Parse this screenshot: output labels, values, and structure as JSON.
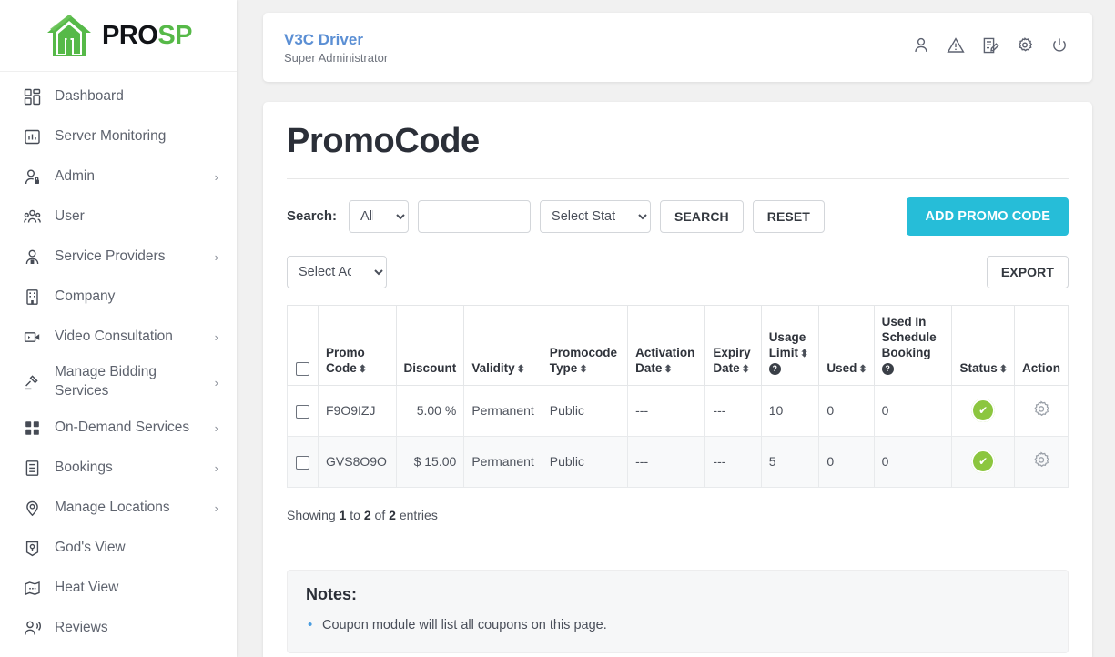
{
  "brand": {
    "logo_pro": "PRO",
    "logo_sp": "SP",
    "logo_icon": "house-icon",
    "green": "#56b948"
  },
  "sidebar": {
    "items": [
      {
        "label": "Dashboard",
        "icon": "grid-dashboard-icon",
        "caret": ""
      },
      {
        "label": "Server Monitoring",
        "icon": "chart-monitor-icon",
        "caret": ""
      },
      {
        "label": "Admin",
        "icon": "user-lock-icon",
        "caret": "›"
      },
      {
        "label": "User",
        "icon": "users-group-icon",
        "caret": ""
      },
      {
        "label": "Service Providers",
        "icon": "user-badge-icon",
        "caret": "›"
      },
      {
        "label": "Company",
        "icon": "building-icon",
        "caret": ""
      },
      {
        "label": "Video Consultation",
        "icon": "video-camera-icon",
        "caret": "›"
      },
      {
        "label": "Manage Bidding Services",
        "icon": "gavel-icon",
        "caret": "›"
      },
      {
        "label": "On-Demand Services",
        "icon": "grid-squares-icon",
        "caret": "›"
      },
      {
        "label": "Bookings",
        "icon": "list-document-icon",
        "caret": "›"
      },
      {
        "label": "Manage Locations",
        "icon": "map-pin-icon",
        "caret": "›"
      },
      {
        "label": "God's View",
        "icon": "map-location-icon",
        "caret": ""
      },
      {
        "label": "Heat View",
        "icon": "heat-map-icon",
        "caret": ""
      },
      {
        "label": "Reviews",
        "icon": "user-voice-icon",
        "caret": ""
      }
    ]
  },
  "topbar": {
    "title": "V3C Driver",
    "subtitle": "Super Administrator",
    "title_color": "#5b8fd4",
    "icons": [
      {
        "name": "user-icon"
      },
      {
        "name": "warning-triangle-icon"
      },
      {
        "name": "edit-document-icon"
      },
      {
        "name": "gear-icon"
      },
      {
        "name": "power-icon"
      }
    ]
  },
  "page": {
    "title": "PromoCode"
  },
  "filters": {
    "search_label": "Search:",
    "field_select_value": "All",
    "field_select_options": [
      "All"
    ],
    "search_input_value": "",
    "search_input_placeholder": "",
    "status_select_value": "Select Status",
    "status_select_options": [
      "Select Status"
    ],
    "search_button": "SEARCH",
    "reset_button": "RESET",
    "add_button": "ADD PROMO CODE",
    "add_button_color": "#26bdd8"
  },
  "actions": {
    "action_select_value": "Select Action",
    "action_select_options": [
      "Select Action"
    ],
    "export_button": "EXPORT"
  },
  "table": {
    "columns": [
      {
        "label": "",
        "sortable": false,
        "help": false
      },
      {
        "label": "Promo Code",
        "sortable": true,
        "help": false
      },
      {
        "label": "Discount",
        "sortable": false,
        "help": false
      },
      {
        "label": "Validity",
        "sortable": true,
        "help": false
      },
      {
        "label": "Promocode Type",
        "sortable": true,
        "help": false
      },
      {
        "label": "Activation Date",
        "sortable": true,
        "help": false
      },
      {
        "label": "Expiry Date",
        "sortable": true,
        "help": false
      },
      {
        "label": "Usage Limit",
        "sortable": true,
        "help": true
      },
      {
        "label": "Used",
        "sortable": true,
        "help": false
      },
      {
        "label": "Used In Schedule Booking",
        "sortable": false,
        "help": true
      },
      {
        "label": "Status",
        "sortable": true,
        "help": false
      },
      {
        "label": "Action",
        "sortable": false,
        "help": false
      }
    ],
    "rows": [
      {
        "promo_code": "F9O9IZJ",
        "discount": "5.00 %",
        "validity": "Permanent",
        "promocode_type": "Public",
        "activation_date": "---",
        "expiry_date": "---",
        "usage_limit": "10",
        "used": "0",
        "used_in_schedule_booking": "0",
        "status": "active",
        "status_color": "#8cc63f"
      },
      {
        "promo_code": "GVS8O9O",
        "discount": "$ 15.00",
        "validity": "Permanent",
        "promocode_type": "Public",
        "activation_date": "---",
        "expiry_date": "---",
        "usage_limit": "5",
        "used": "0",
        "used_in_schedule_booking": "0",
        "status": "active",
        "status_color": "#8cc63f"
      }
    ]
  },
  "footer": {
    "showing_prefix": "Showing",
    "showing_from": "1",
    "showing_to_word": "to",
    "showing_to": "2",
    "showing_of_word": "of",
    "showing_total": "2",
    "showing_suffix": "entries"
  },
  "notes": {
    "title": "Notes:",
    "items": [
      "Coupon module will list all coupons on this page."
    ]
  }
}
